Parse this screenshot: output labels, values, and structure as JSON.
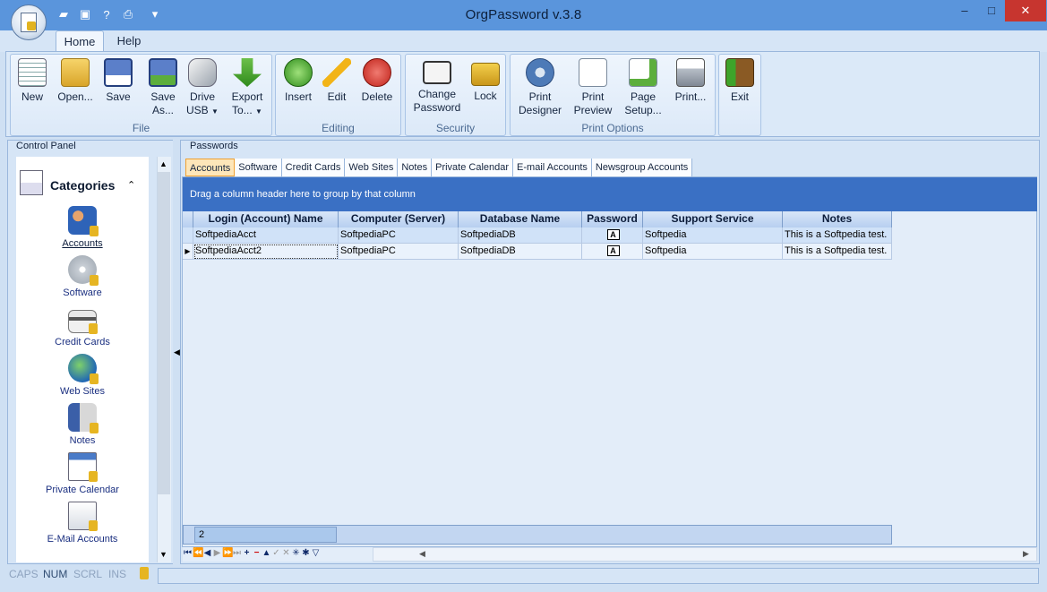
{
  "window": {
    "title": "OrgPassword v.3.8",
    "minimize": "–",
    "maximize": "□",
    "close": "✕"
  },
  "qat": {
    "icons": [
      "folder-open-icon",
      "save-icon",
      "help-icon",
      "print-icon"
    ],
    "more": "▾"
  },
  "tabs": {
    "home": "Home",
    "help": "Help"
  },
  "ribbon": {
    "groups": {
      "file": "File",
      "editing": "Editing",
      "security": "Security",
      "print_options": "Print Options"
    },
    "buttons": {
      "new": {
        "l1": "New",
        "l2": ""
      },
      "open": {
        "l1": "Open...",
        "l2": ""
      },
      "save": {
        "l1": "Save",
        "l2": ""
      },
      "save_as": {
        "l1": "Save",
        "l2": "As..."
      },
      "drive_usb": {
        "l1": "Drive",
        "l2": "USB"
      },
      "export": {
        "l1": "Export",
        "l2": "To..."
      },
      "insert": {
        "l1": "Insert",
        "l2": ""
      },
      "edit": {
        "l1": "Edit",
        "l2": ""
      },
      "delete": {
        "l1": "Delete",
        "l2": ""
      },
      "change_password": {
        "l1": "Change",
        "l2": "Password"
      },
      "lock": {
        "l1": "Lock",
        "l2": ""
      },
      "print_designer": {
        "l1": "Print",
        "l2": "Designer"
      },
      "print_preview": {
        "l1": "Print",
        "l2": "Preview"
      },
      "page_setup": {
        "l1": "Page",
        "l2": "Setup..."
      },
      "print": {
        "l1": "Print...",
        "l2": ""
      },
      "exit": {
        "l1": "Exit",
        "l2": ""
      }
    }
  },
  "control_panel": {
    "title": "Control Panel",
    "header": "Categories",
    "collapse": "⌃",
    "categories": [
      "Accounts",
      "Software",
      "Credit Cards",
      "Web Sites",
      "Notes",
      "Private Calendar",
      "E-Mail Accounts"
    ]
  },
  "passwords": {
    "title": "Passwords",
    "tabs": [
      "Accounts",
      "Software",
      "Credit Cards",
      "Web Sites",
      "Notes",
      "Private Calendar",
      "E-mail Accounts",
      "Newsgroup Accounts"
    ],
    "group_hint": "Drag a column header here to group by that column",
    "columns": [
      "Login (Account) Name",
      "Computer (Server)",
      "Database Name",
      "Password",
      "Support Service",
      "Notes"
    ],
    "rows": [
      {
        "login": "SoftpediaAcct",
        "computer": "SoftpediaPC",
        "database": "SoftpediaDB",
        "password": "A",
        "support": "Softpedia",
        "notes": "This is a Softpedia test."
      },
      {
        "login": "SoftpediaAcct2",
        "computer": "SoftpediaPC",
        "database": "SoftpediaDB",
        "password": "A",
        "support": "Softpedia",
        "notes": "This is a Softpedia test."
      }
    ],
    "count": "2"
  },
  "status": {
    "caps": "CAPS",
    "num": "NUM",
    "scrl": "SCRL",
    "ins": "INS"
  },
  "colors": {
    "titlebar": "#5a95dc",
    "accent": "#3a70c4",
    "close": "#c7352f"
  }
}
